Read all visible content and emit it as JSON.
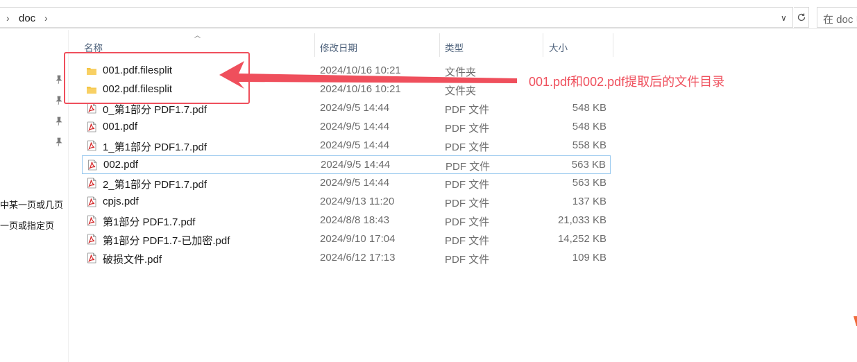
{
  "address_bar": {
    "breadcrumb": "doc",
    "search_placeholder": "在 doc 中搜索"
  },
  "nav_pane": {
    "truncated_items": [
      "中某一页或几页",
      "一页或指定页"
    ]
  },
  "columns": {
    "name": "名称",
    "date": "修改日期",
    "type": "类型",
    "size": "大小"
  },
  "files": [
    {
      "name": "001.pdf.filesplit",
      "date": "2024/10/16 10:21",
      "type": "文件夹",
      "size": "",
      "icon": "folder-icon"
    },
    {
      "name": "002.pdf.filesplit",
      "date": "2024/10/16 10:21",
      "type": "文件夹",
      "size": "",
      "icon": "folder-icon"
    },
    {
      "name": "0_第1部分 PDF1.7.pdf",
      "date": "2024/9/5 14:44",
      "type": "PDF 文件",
      "size": "548 KB",
      "icon": "pdf-file-icon"
    },
    {
      "name": "001.pdf",
      "date": "2024/9/5 14:44",
      "type": "PDF 文件",
      "size": "548 KB",
      "icon": "pdf-file-icon"
    },
    {
      "name": "1_第1部分 PDF1.7.pdf",
      "date": "2024/9/5 14:44",
      "type": "PDF 文件",
      "size": "558 KB",
      "icon": "pdf-file-icon"
    },
    {
      "name": "002.pdf",
      "date": "2024/9/5 14:44",
      "type": "PDF 文件",
      "size": "563 KB",
      "icon": "pdf-file-icon"
    },
    {
      "name": "2_第1部分 PDF1.7.pdf",
      "date": "2024/9/5 14:44",
      "type": "PDF 文件",
      "size": "563 KB",
      "icon": "pdf-file-icon"
    },
    {
      "name": "cpjs.pdf",
      "date": "2024/9/13 11:20",
      "type": "PDF 文件",
      "size": "137 KB",
      "icon": "pdf-file-icon"
    },
    {
      "name": "第1部分 PDF1.7.pdf",
      "date": "2024/8/8 18:43",
      "type": "PDF 文件",
      "size": "21,033 KB",
      "icon": "pdf-file-icon"
    },
    {
      "name": "第1部分 PDF1.7-已加密.pdf",
      "date": "2024/9/10 17:04",
      "type": "PDF 文件",
      "size": "14,252 KB",
      "icon": "pdf-file-icon"
    },
    {
      "name": "破损文件.pdf",
      "date": "2024/6/12 17:13",
      "type": "PDF 文件",
      "size": "109 KB",
      "icon": "pdf-file-icon"
    }
  ],
  "selected_file": "002.pdf",
  "annotation": {
    "text": "001.pdf和002.pdf提取后的文件目录",
    "color": "#ef4f5c"
  },
  "colors": {
    "folder": "#f4c542",
    "pdf_red": "#d5292a",
    "selection_border": "#99c9ef",
    "header_text": "#4c607a"
  }
}
